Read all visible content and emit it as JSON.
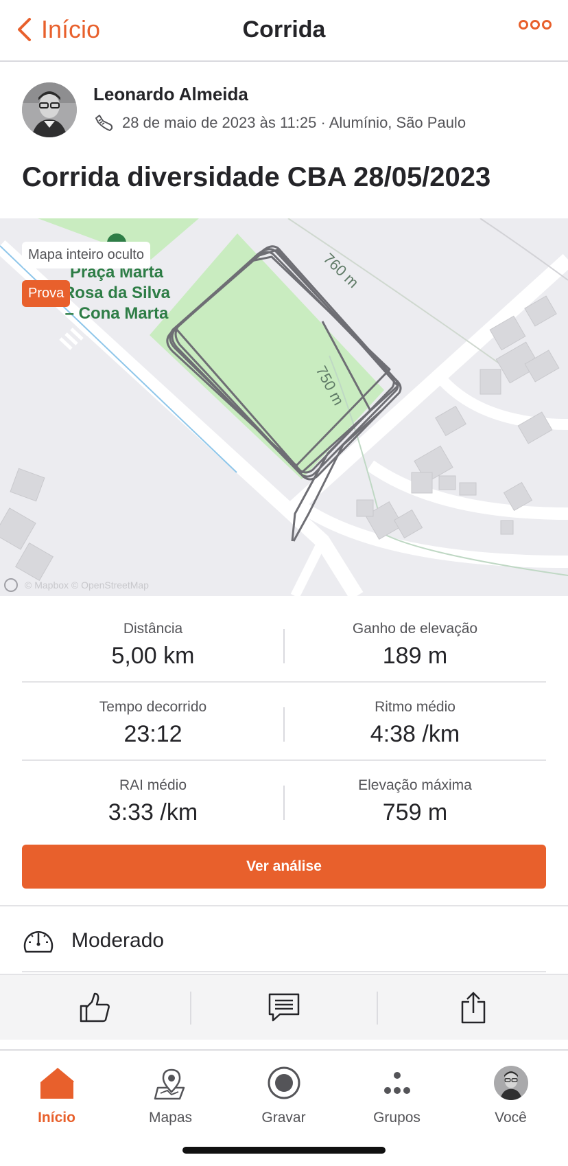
{
  "header": {
    "back_label": "Início",
    "title": "Corrida"
  },
  "athlete": {
    "name": "Leonardo Almeida",
    "meta": "28 de maio de 2023 às 11:25 · Alumínio, São Paulo"
  },
  "activity": {
    "title": "Corrida diversidade CBA 28/05/2023"
  },
  "map": {
    "hidden_label": "Mapa inteiro oculto",
    "race_badge": "Prova",
    "place_label": [
      "Praça Marta",
      "Rosa da Silva",
      "– Cona Marta"
    ],
    "contour_upper": "760 m",
    "contour_lower": "750 m",
    "attribution": "© Mapbox © OpenStreetMap"
  },
  "stats": [
    {
      "label": "Distância",
      "value": "5,00 km"
    },
    {
      "label": "Ganho de elevação",
      "value": "189 m"
    },
    {
      "label": "Tempo decorrido",
      "value": "23:12"
    },
    {
      "label": "Ritmo médio",
      "value": "4:38 /km"
    },
    {
      "label": "RAI médio",
      "value": "3:33 /km"
    },
    {
      "label": "Elevação máxima",
      "value": "759 m"
    }
  ],
  "cta_label": "Ver análise",
  "effort_label": "Moderado",
  "tabs": [
    {
      "label": "Início",
      "icon": "home-icon",
      "active": true
    },
    {
      "label": "Mapas",
      "icon": "map-pin-icon"
    },
    {
      "label": "Gravar",
      "icon": "record-icon"
    },
    {
      "label": "Grupos",
      "icon": "groups-icon"
    },
    {
      "label": "Você",
      "icon": "avatar"
    }
  ],
  "colors": {
    "accent": "#e8602c",
    "text": "#242428",
    "muted": "#545458",
    "map_bg": "#ececf0",
    "park": "#c9ecc0",
    "route": "#6e6e74"
  }
}
